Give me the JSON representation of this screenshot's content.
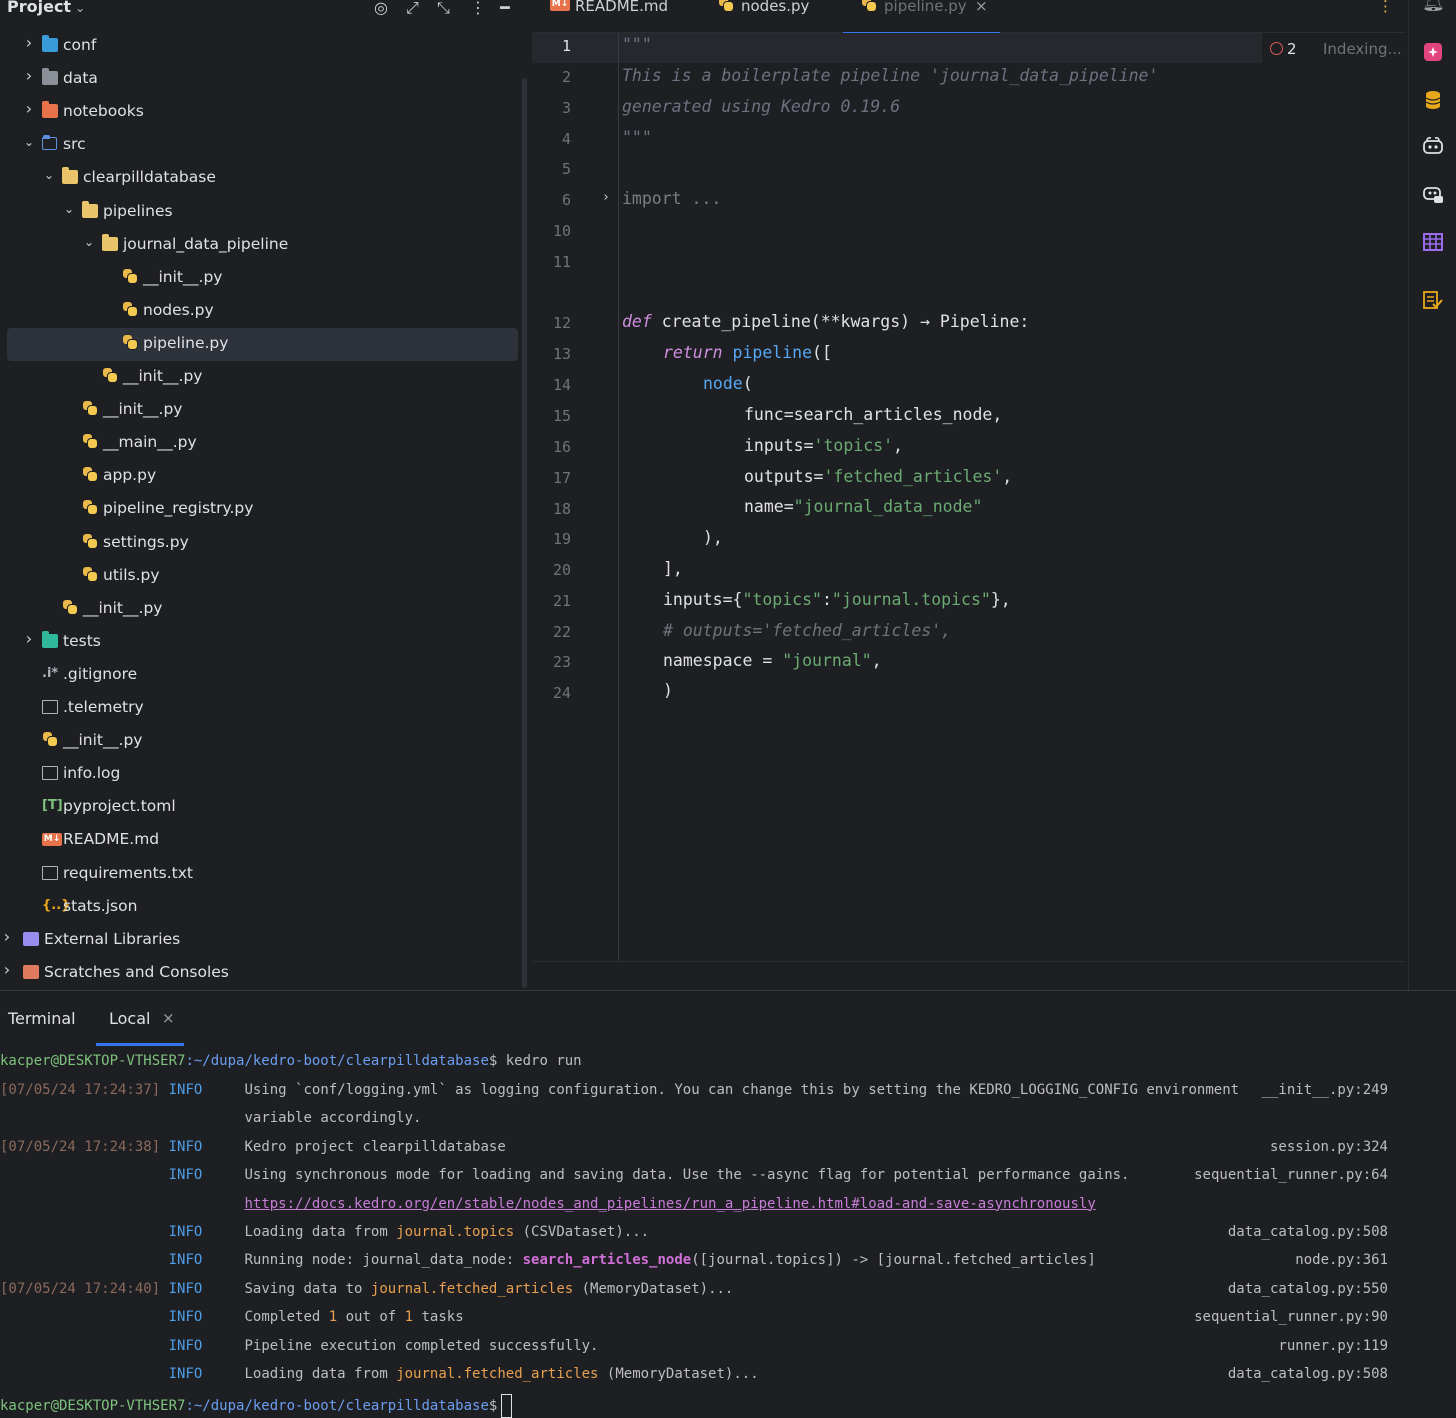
{
  "project": {
    "title": "Project",
    "tree": [
      {
        "label": "conf",
        "depth": 0,
        "expanded": false,
        "icon": "folder-config"
      },
      {
        "label": "data",
        "depth": 0,
        "expanded": false,
        "icon": "folder-grey"
      },
      {
        "label": "notebooks",
        "depth": 0,
        "expanded": false,
        "icon": "folder-orange"
      },
      {
        "label": "src",
        "depth": 0,
        "expanded": true,
        "icon": "folder-source"
      },
      {
        "label": "clearpilldatabase",
        "depth": 1,
        "expanded": true,
        "icon": "folder"
      },
      {
        "label": "pipelines",
        "depth": 2,
        "expanded": true,
        "icon": "folder"
      },
      {
        "label": "journal_data_pipeline",
        "depth": 3,
        "expanded": true,
        "icon": "folder"
      },
      {
        "label": "__init__.py",
        "depth": 4,
        "icon": "python"
      },
      {
        "label": "nodes.py",
        "depth": 4,
        "icon": "python"
      },
      {
        "label": "pipeline.py",
        "depth": 4,
        "icon": "python",
        "selected": true
      },
      {
        "label": "__init__.py",
        "depth": 3,
        "icon": "python"
      },
      {
        "label": "__init__.py",
        "depth": 2,
        "icon": "python"
      },
      {
        "label": "__main__.py",
        "depth": 2,
        "icon": "python"
      },
      {
        "label": "app.py",
        "depth": 2,
        "icon": "python"
      },
      {
        "label": "pipeline_registry.py",
        "depth": 2,
        "icon": "python"
      },
      {
        "label": "settings.py",
        "depth": 2,
        "icon": "python"
      },
      {
        "label": "utils.py",
        "depth": 2,
        "icon": "python"
      },
      {
        "label": "__init__.py",
        "depth": 1,
        "icon": "python"
      },
      {
        "label": "tests",
        "depth": 0,
        "expanded": false,
        "icon": "folder-teal"
      },
      {
        "label": ".gitignore",
        "depth": 0,
        "icon": "gitignore"
      },
      {
        "label": ".telemetry",
        "depth": 0,
        "icon": "file"
      },
      {
        "label": "__init__.py",
        "depth": 0,
        "icon": "python"
      },
      {
        "label": "info.log",
        "depth": 0,
        "icon": "file"
      },
      {
        "label": "pyproject.toml",
        "depth": 0,
        "icon": "toml"
      },
      {
        "label": "README.md",
        "depth": 0,
        "icon": "markdown"
      },
      {
        "label": "requirements.txt",
        "depth": 0,
        "icon": "file"
      },
      {
        "label": "stats.json",
        "depth": 0,
        "icon": "json"
      },
      {
        "label": "External Libraries",
        "depth": -1,
        "expanded": false,
        "icon": "library"
      },
      {
        "label": "Scratches and Consoles",
        "depth": -1,
        "expanded": false,
        "icon": "scratches"
      }
    ]
  },
  "tabs": [
    {
      "label": "README.md",
      "icon": "markdown"
    },
    {
      "label": "nodes.py",
      "icon": "python"
    },
    {
      "label": "pipeline.py",
      "icon": "python",
      "active": true
    }
  ],
  "editor": {
    "error_count": "2",
    "status": "Indexing...",
    "lines": [
      {
        "n": "1",
        "cur": true
      },
      {
        "n": "2"
      },
      {
        "n": "3"
      },
      {
        "n": "4"
      },
      {
        "n": "5"
      },
      {
        "n": "6"
      },
      {
        "n": "10"
      },
      {
        "n": "11"
      },
      {
        "n": "12"
      },
      {
        "n": "13"
      },
      {
        "n": "14"
      },
      {
        "n": "15"
      },
      {
        "n": "16"
      },
      {
        "n": "17"
      },
      {
        "n": "18"
      },
      {
        "n": "19"
      },
      {
        "n": "20"
      },
      {
        "n": "21"
      },
      {
        "n": "22"
      },
      {
        "n": "23"
      },
      {
        "n": "24"
      }
    ],
    "code": {
      "l1": "\"\"\"",
      "l2": "This is a boilerplate pipeline 'journal_data_pipeline'",
      "l3": "generated using Kedro 0.19.6",
      "l4": "\"\"\"",
      "l6_kw": "import",
      "l6_rest": " ...",
      "l12_def": "def",
      "l12_name": " create_pipeline(**kwargs) ",
      "l12_arrow": "→",
      "l12_ret": " Pipeline:",
      "l13_kw": "return",
      "l13_fn": " pipeline",
      "l13_rest": "([",
      "l14_fn": "node",
      "l14_rest": "(",
      "l15": "func=search_articles_node,",
      "l16_a": "inputs=",
      "l16_s": "'topics'",
      "l16_b": ",",
      "l17_a": "outputs=",
      "l17_s": "'fetched_articles'",
      "l17_b": ",",
      "l18_a": "name=",
      "l18_s": "\"journal_data_node\"",
      "l19": "),",
      "l20": "],",
      "l21_a": "inputs={",
      "l21_s1": "\"topics\"",
      "l21_c": ":",
      "l21_s2": "\"journal.topics\"",
      "l21_b": "},",
      "l22": "# outputs='fetched_articles',",
      "l23_a": "namespace = ",
      "l23_s": "\"journal\"",
      "l23_b": ",",
      "l24": ")"
    }
  },
  "terminal": {
    "tab_title": "Terminal",
    "tab_local": "Local",
    "prompt_user": "kacper@DESKTOP-VTHSER7",
    "prompt_path": ":~/dupa/kedro-boot/clearpilldatabase",
    "prompt_sign": "$",
    "command": " kedro run",
    "rows": [
      {
        "ts": "[07/05/24 17:24:37]",
        "lvl": "INFO",
        "msg": "Using `conf/logging.yml` as logging configuration. You can change this by setting the KEDRO_LOGGING_CONFIG environment",
        "src": "__init__.py:249"
      },
      {
        "ts": "",
        "lvl": "",
        "msg": "variable accordingly.",
        "src": ""
      },
      {
        "ts": "[07/05/24 17:24:38]",
        "lvl": "INFO",
        "msg": "Kedro project clearpilldatabase",
        "src": "session.py:324"
      },
      {
        "ts": "",
        "lvl": "INFO",
        "msg": "Using synchronous mode for loading and saving data. Use the --async flag for potential performance gains.",
        "src": "sequential_runner.py:64"
      },
      {
        "ts": "",
        "lvl": "",
        "link": "https://docs.kedro.org/en/stable/nodes_and_pipelines/run_a_pipeline.html#load-and-save-asynchronously",
        "src": ""
      },
      {
        "ts": "",
        "lvl": "INFO",
        "pre": "Loading data from ",
        "hl": "journal.topics",
        "post": " (CSVDataset)...",
        "src": "data_catalog.py:508"
      },
      {
        "ts": "",
        "lvl": "INFO",
        "pre": "Running node: journal_data_node: ",
        "fn": "search_articles_node",
        "post": "([journal.topics]) -> [journal.fetched_articles]",
        "src": "node.py:361"
      },
      {
        "ts": "[07/05/24 17:24:40]",
        "lvl": "INFO",
        "pre": "Saving data to ",
        "hl": "journal.fetched_articles",
        "post": " (MemoryDataset)...",
        "src": "data_catalog.py:550"
      },
      {
        "ts": "",
        "lvl": "INFO",
        "pre": "Completed ",
        "n1": "1",
        "mid": " out of ",
        "n2": "1",
        "post": " tasks",
        "src": "sequential_runner.py:90"
      },
      {
        "ts": "",
        "lvl": "INFO",
        "msg": "Pipeline execution completed successfully.",
        "src": "runner.py:119"
      },
      {
        "ts": "",
        "lvl": "INFO",
        "pre": "Loading data from ",
        "hl": "journal.fetched_articles",
        "post": " (MemoryDataset)...",
        "src": "data_catalog.py:508"
      }
    ]
  },
  "colors": {
    "accent": "#3574f0",
    "background": "#1e1f22",
    "selection": "#2e323a"
  }
}
